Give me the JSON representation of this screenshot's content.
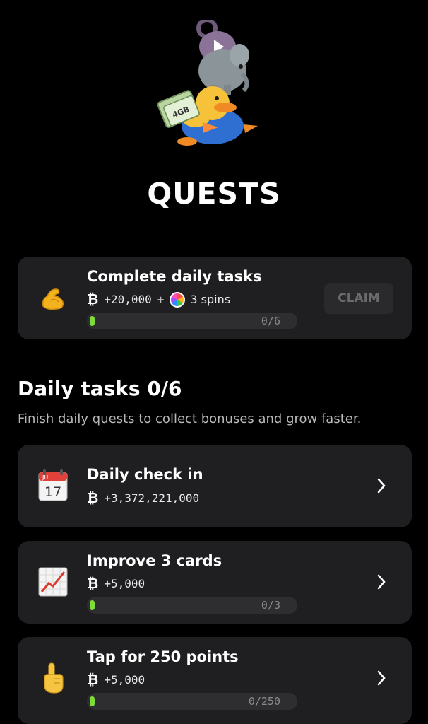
{
  "page": {
    "title": "QUESTS"
  },
  "summary_card": {
    "title": "Complete daily tasks",
    "coin_symbol": "₿",
    "reward": "+20,000",
    "plus": "+",
    "spins": "3 spins",
    "progress_text": "0/6",
    "progress": 0,
    "claim_label": "CLAIM",
    "icon": "flexed-biceps-icon"
  },
  "daily": {
    "heading": "Daily tasks 0/6",
    "subtitle": "Finish daily quests to collect bonuses and grow faster.",
    "tasks": [
      {
        "title": "Daily check in",
        "reward": "+3,372,221,000",
        "icon": "calendar-icon",
        "calendar_month": "JUL",
        "calendar_day": "17"
      },
      {
        "title": "Improve 3 cards",
        "reward": "+5,000",
        "progress_text": "0/3",
        "progress": 0,
        "icon": "chart-increasing-icon"
      },
      {
        "title": "Tap for 250 points",
        "reward": "+5,000",
        "progress_text": "0/250",
        "progress": 0,
        "icon": "pointing-up-icon"
      }
    ]
  },
  "hero": {
    "gb_label": "4GB"
  },
  "colors": {
    "background": "#000000",
    "card": "#1f1f21",
    "progress_fill": "#7ddc3a",
    "claim_disabled": "#6a6a6a"
  }
}
